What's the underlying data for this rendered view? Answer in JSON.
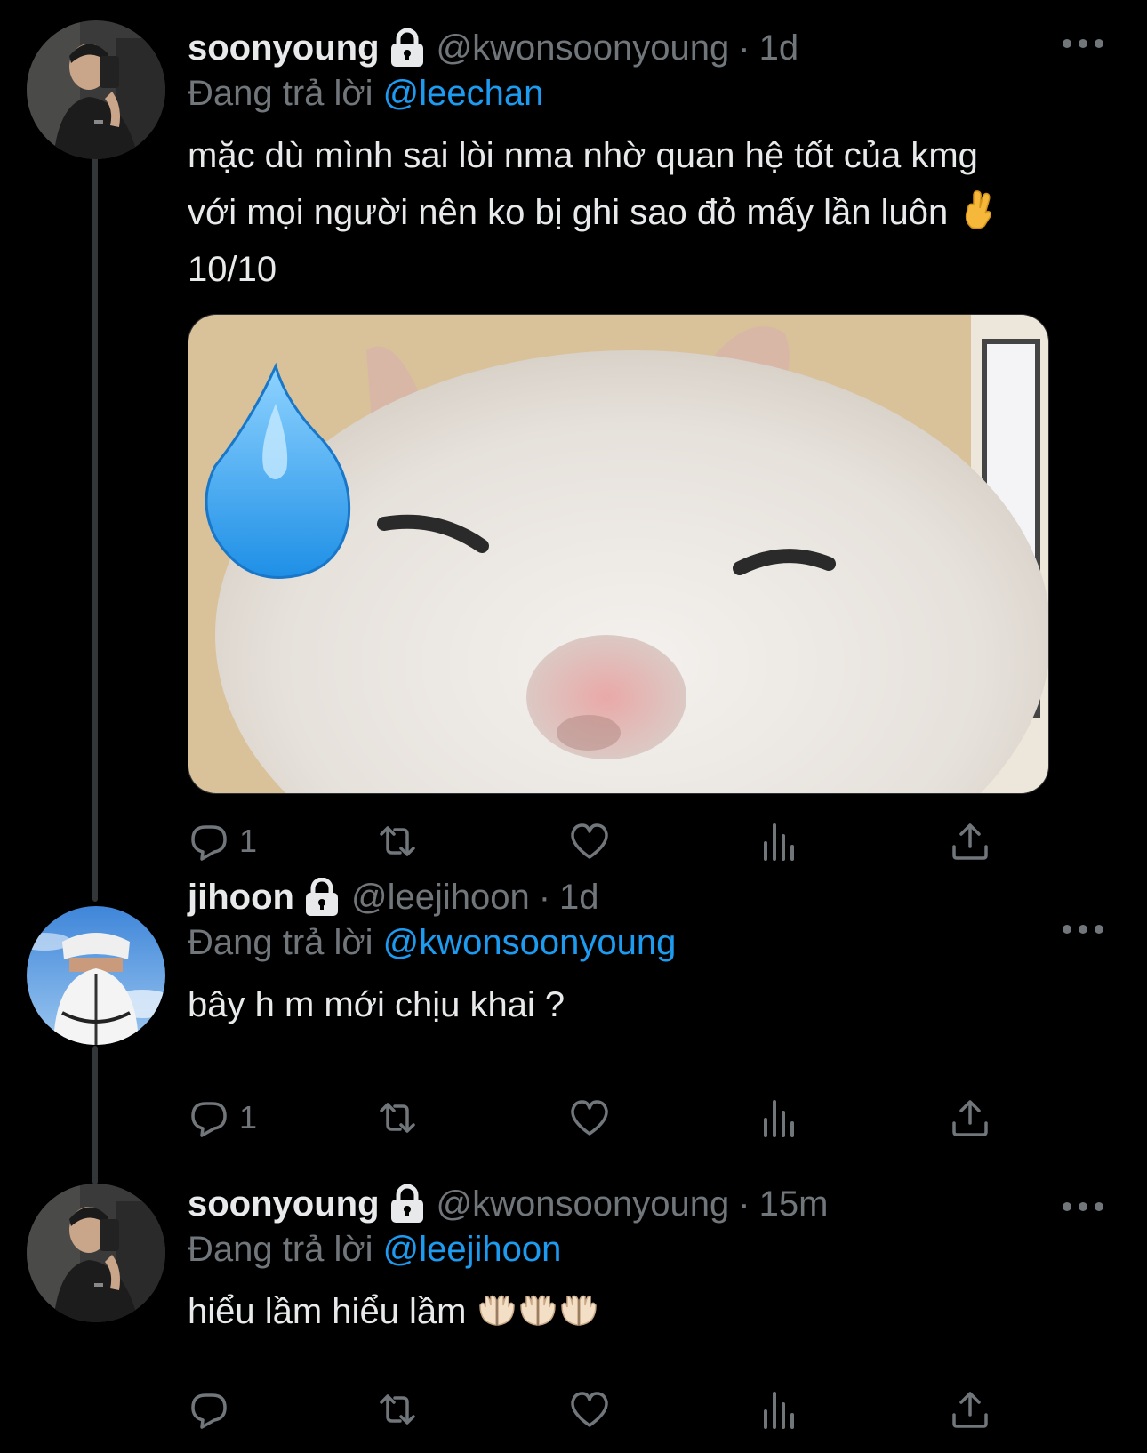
{
  "tweets": [
    {
      "display_name": "soonyoung",
      "handle": "@kwonsoonyoung",
      "time": "1d",
      "reply_prefix": "Đang trả lời",
      "reply_to": "@leechan",
      "text": "mặc dù mình sai lòi nma nhờ quan hệ tốt của kmg\nvới mọi người nên ko bị ghi sao đỏ mấy lần luôn ",
      "text_emoji": "crossed-fingers-emoji",
      "text_tail": "\n10/10",
      "media": "white-cat-wink-sweat-drop-meme",
      "reply_count": "1",
      "retweet_count": "",
      "like_count": ""
    },
    {
      "display_name": "jihoon",
      "handle": "@leejihoon",
      "time": "1d",
      "reply_prefix": "Đang trả lời",
      "reply_to": "@kwonsoonyoung",
      "text": "bây h m mới chịu khai ?",
      "reply_count": "1",
      "retweet_count": "",
      "like_count": ""
    },
    {
      "display_name": "soonyoung",
      "handle": "@kwonsoonyoung",
      "time": "15m",
      "reply_prefix": "Đang trả lời",
      "reply_to": "@leejihoon",
      "text": "hiểu lầm hiểu lầm ",
      "text_emoji": "palms-up-together-emoji x3",
      "reply_count": "",
      "retweet_count": "",
      "like_count": ""
    }
  ],
  "icons": {
    "lock": "lock-icon",
    "more": "more-icon",
    "reply": "reply-icon",
    "retweet": "retweet-icon",
    "like": "heart-icon",
    "views": "views-icon",
    "share": "share-icon"
  },
  "colors": {
    "background": "#000000",
    "text": "#e7e9ea",
    "muted": "#71767b",
    "accent": "#1d9bf0",
    "thread_line": "#333639"
  }
}
